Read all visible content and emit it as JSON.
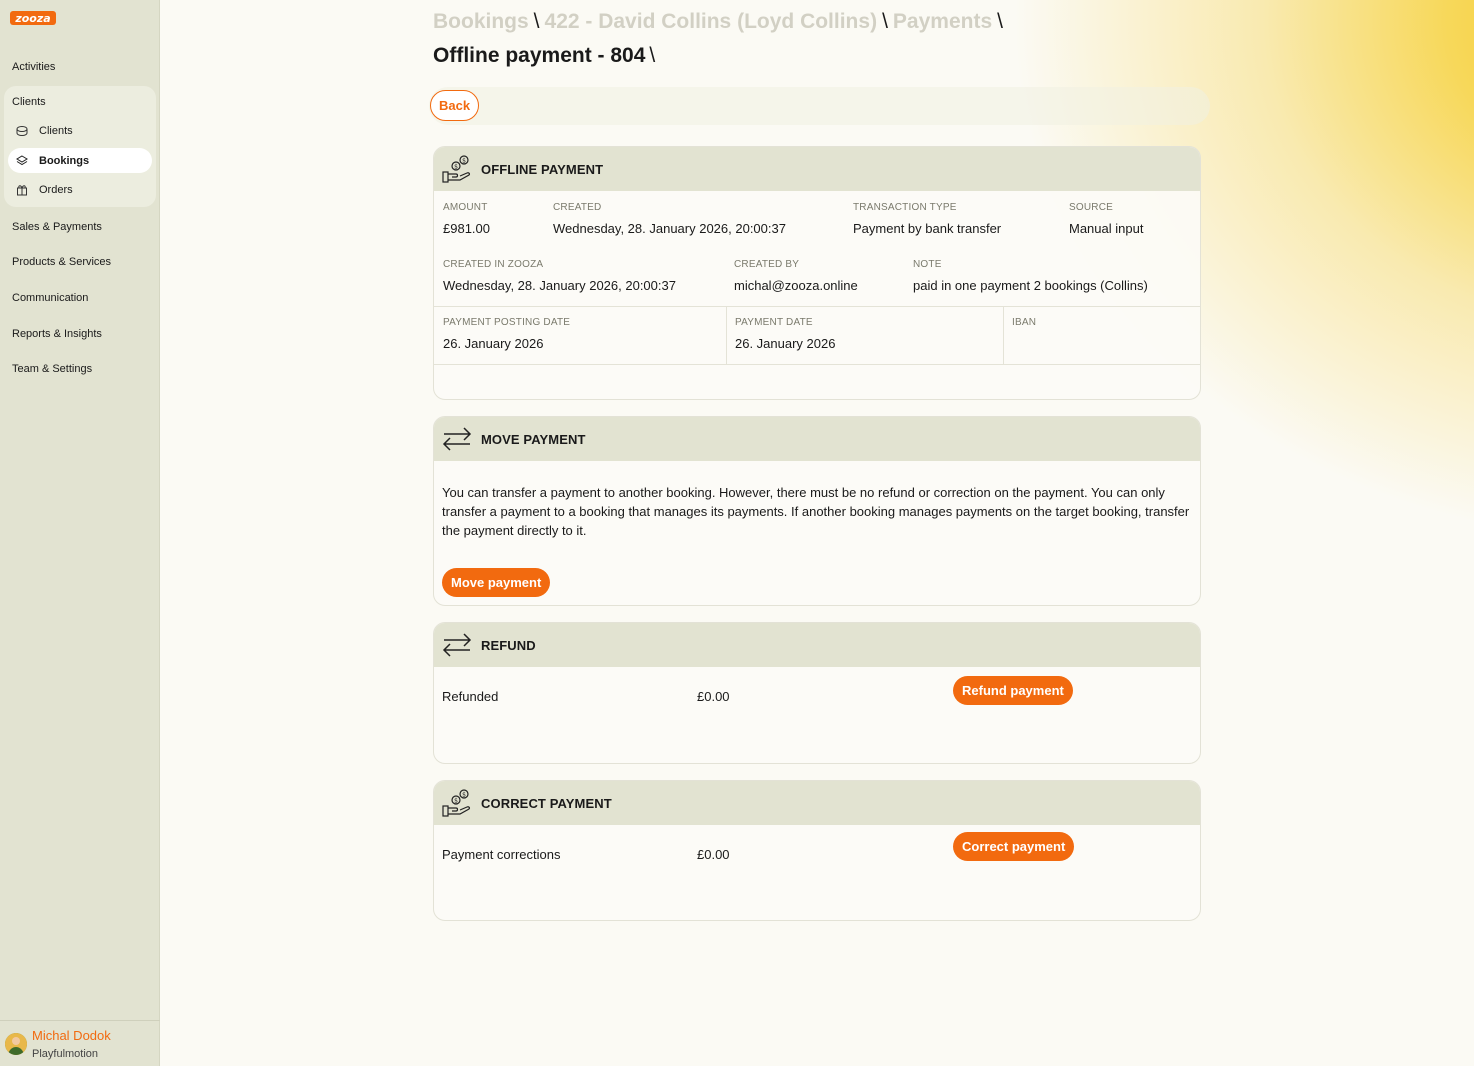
{
  "app": {
    "logo_text": "zooza"
  },
  "sidebar": {
    "activities": "Activities",
    "clients_group": "Clients",
    "sub_items": [
      {
        "label": "Clients",
        "icon": "clients-icon"
      },
      {
        "label": "Bookings",
        "icon": "bookings-icon"
      },
      {
        "label": "Orders",
        "icon": "orders-icon"
      }
    ],
    "sales": "Sales & Payments",
    "products": "Products & Services",
    "communication": "Communication",
    "reports": "Reports & Insights",
    "team": "Team & Settings"
  },
  "user": {
    "name": "Michal Dodok",
    "org": "Playfulmotion"
  },
  "breadcrumb": {
    "bookings": "Bookings",
    "booking": "422 - David Collins (Loyd Collins)",
    "payments": "Payments",
    "sep": "\\"
  },
  "page_title": "Offline payment - 804",
  "toolbar": {
    "back": "Back"
  },
  "offline_payment": {
    "title": "OFFLINE PAYMENT",
    "amount_label": "AMOUNT",
    "amount": "£981.00",
    "created_label": "CREATED",
    "created": "Wednesday, 28. January 2026, 20:00:37",
    "type_label": "TRANSACTION TYPE",
    "type": "Payment by bank transfer",
    "source_label": "SOURCE",
    "source": "Manual input",
    "created_zooza_label": "CREATED IN ZOOZA",
    "created_zooza": "Wednesday, 28. January 2026, 20:00:37",
    "created_by_label": "CREATED BY",
    "created_by": "michal@zooza.online",
    "note_label": "NOTE",
    "note": "paid in one payment 2 bookings (Collins)",
    "posting_date_label": "PAYMENT POSTING DATE",
    "posting_date": "26. January 2026",
    "payment_date_label": "PAYMENT DATE",
    "payment_date": "26. January 2026",
    "iban_label": "IBAN",
    "iban": ""
  },
  "move_payment": {
    "title": "MOVE PAYMENT",
    "description": "You can transfer a payment to another booking. However, there must be no refund or correction on the payment. You can only transfer a payment to a booking that manages its payments. If another booking manages payments on the target booking, transfer the payment directly to it.",
    "button": "Move payment"
  },
  "refund": {
    "title": "REFUND",
    "label": "Refunded",
    "amount": "£0.00",
    "button": "Refund payment"
  },
  "correct_payment": {
    "title": "CORRECT PAYMENT",
    "label": "Payment corrections",
    "amount": "£0.00",
    "button": "Correct payment"
  },
  "colors": {
    "accent": "#f26a0f",
    "sidebar_bg": "#e2e3d1",
    "glow": "#f5c524"
  }
}
